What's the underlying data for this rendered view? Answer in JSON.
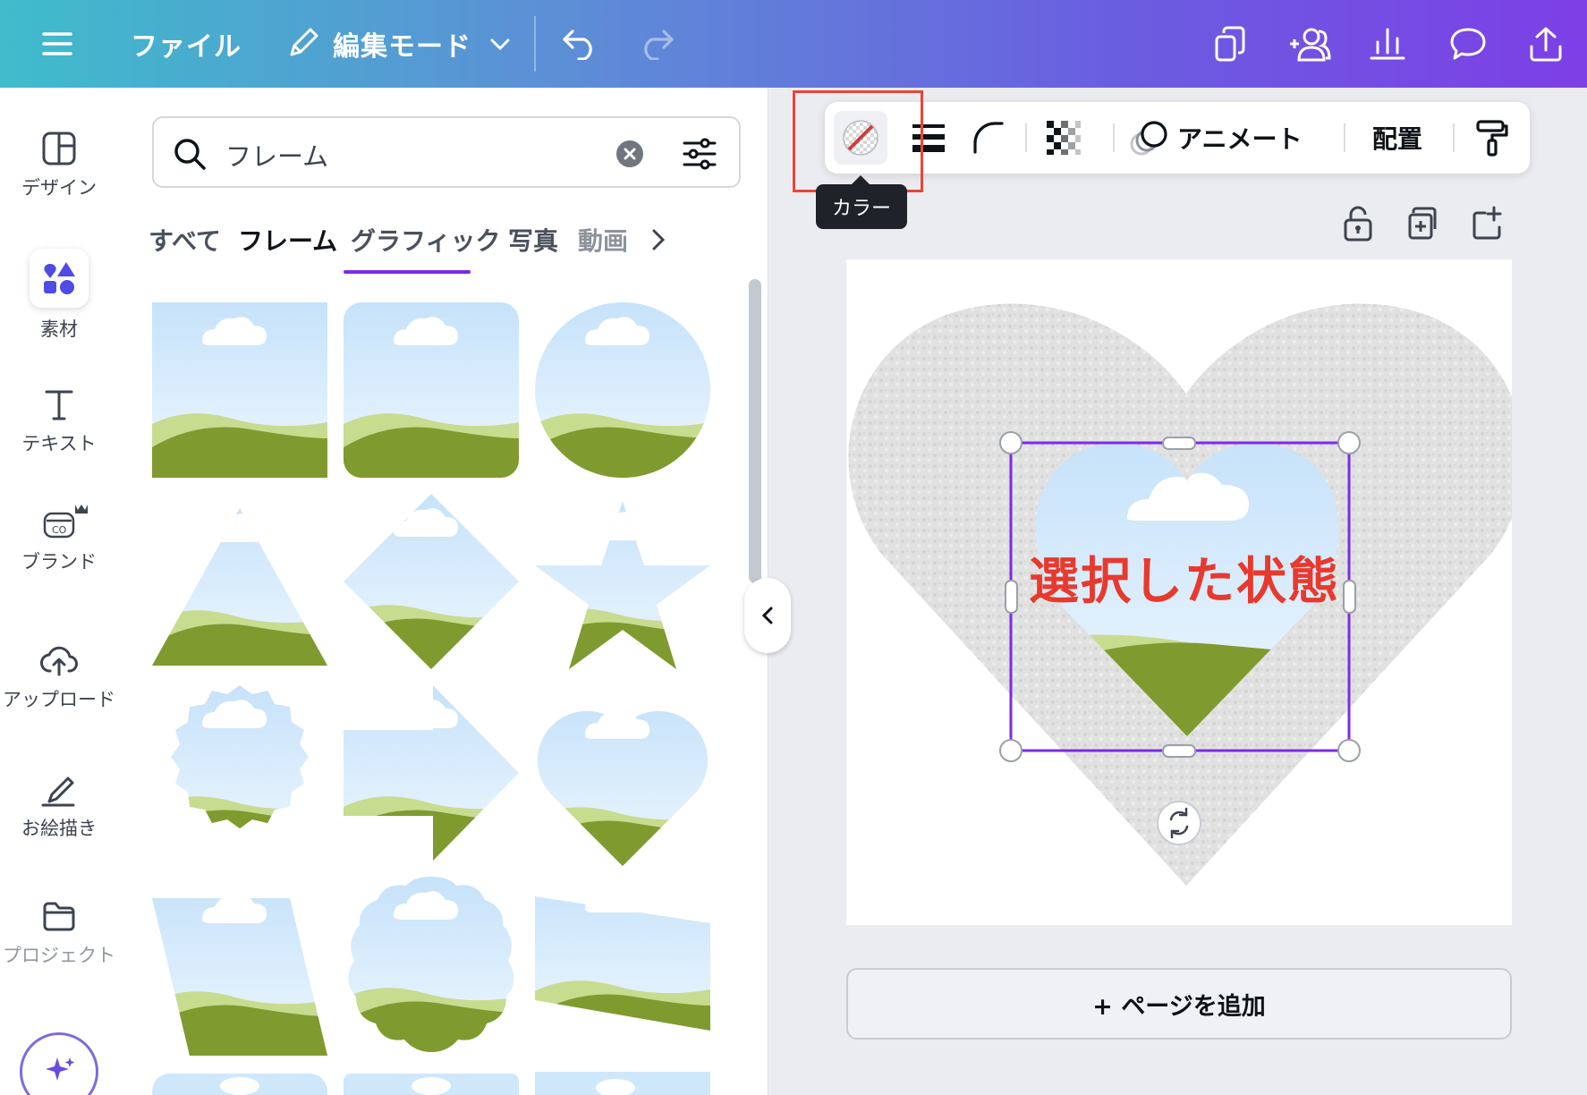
{
  "topbar": {
    "file_label": "ファイル",
    "mode_label": "編集モード"
  },
  "rail": {
    "items": [
      {
        "label": "デザイン",
        "icon": "design-icon"
      },
      {
        "label": "素材",
        "icon": "elements-icon"
      },
      {
        "label": "テキスト",
        "icon": "text-icon"
      },
      {
        "label": "ブランド",
        "icon": "brand-icon"
      },
      {
        "label": "アップロード",
        "icon": "upload-icon"
      },
      {
        "label": "お絵描き",
        "icon": "draw-icon"
      },
      {
        "label": "プロジェクト",
        "icon": "folder-icon"
      }
    ]
  },
  "panel": {
    "search_value": "フレーム",
    "tabs": [
      "すべて",
      "フレーム",
      "グラフィック",
      "写真",
      "動画"
    ],
    "active_tab": "フレーム"
  },
  "toolbar": {
    "animate_label": "アニメート",
    "position_label": "配置",
    "tooltip": "カラー"
  },
  "canvas": {
    "selected_label": "選択した状態",
    "add_page_label": "+ ページを追加"
  },
  "colors": {
    "accent": "#7d2ae8",
    "highlight": "#e8463a",
    "sky": "#cfe7fb",
    "grass_light": "#c4d98a",
    "grass_dark": "#7f9a2f"
  }
}
